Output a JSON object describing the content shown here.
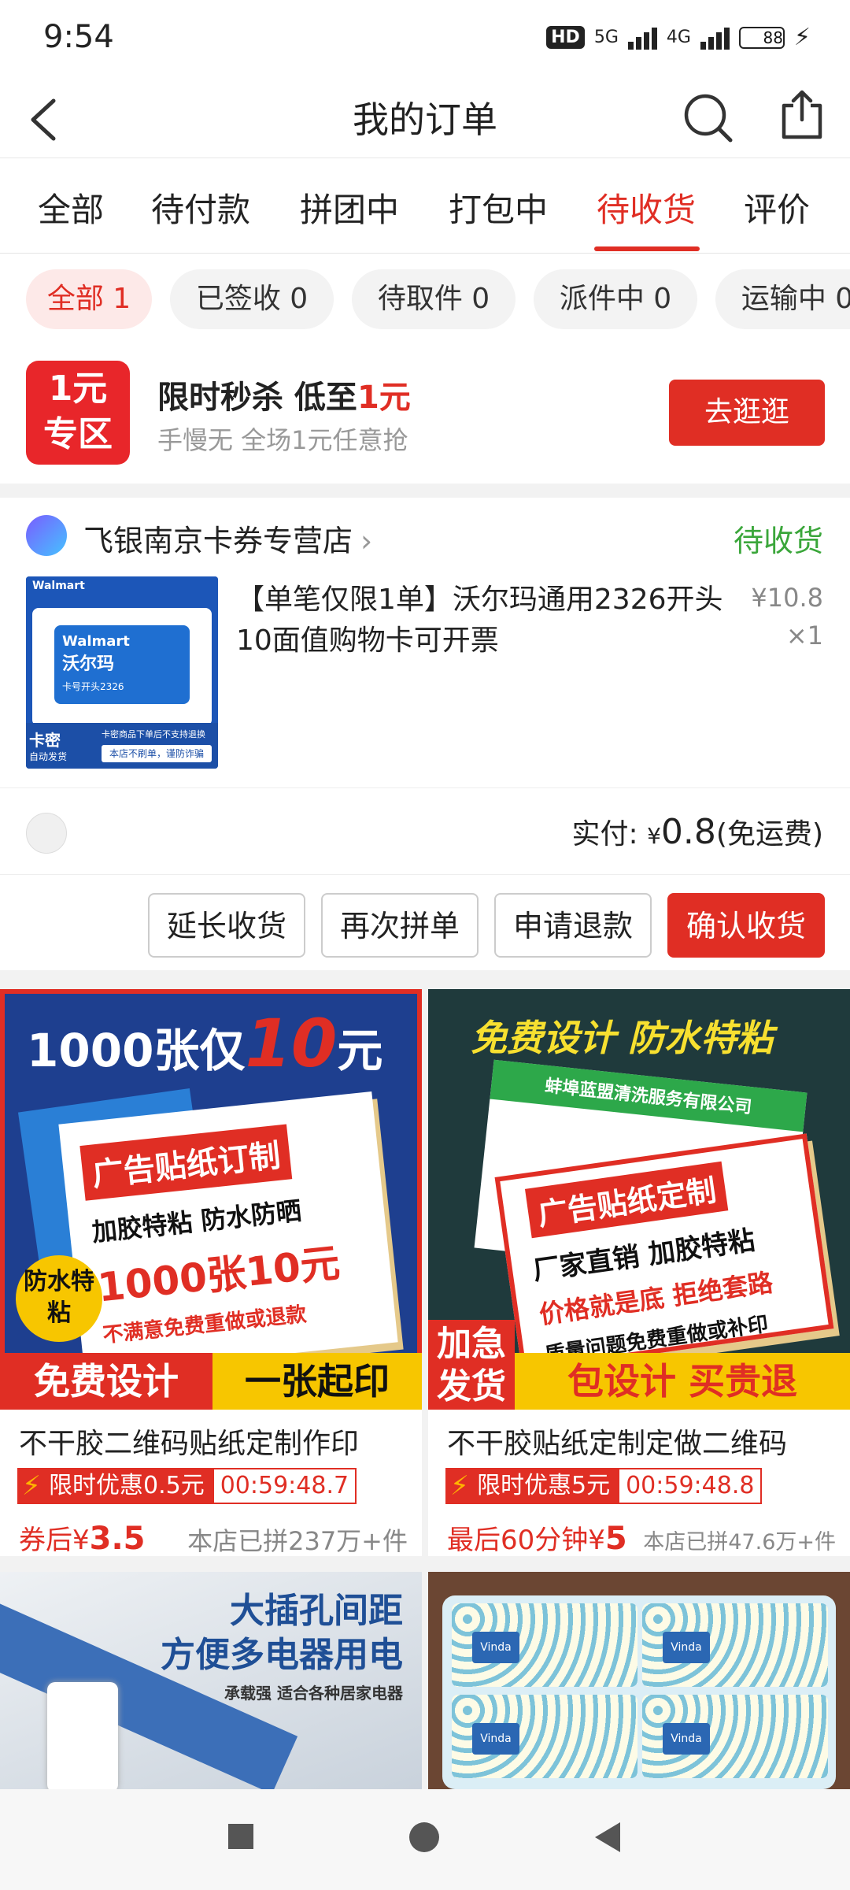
{
  "status_bar": {
    "time": "9:54",
    "hd": "HD",
    "net1": "5G",
    "net2": "4G",
    "battery": "88"
  },
  "header": {
    "title": "我的订单"
  },
  "tabs": [
    {
      "label": "全部"
    },
    {
      "label": "待付款"
    },
    {
      "label": "拼团中"
    },
    {
      "label": "打包中"
    },
    {
      "label": "待收货"
    },
    {
      "label": "评价"
    }
  ],
  "active_tab": "待收货",
  "chips": [
    {
      "label": "全部 1"
    },
    {
      "label": "已签收 0"
    },
    {
      "label": "待取件 0"
    },
    {
      "label": "派件中 0"
    },
    {
      "label": "运输中 0"
    }
  ],
  "promo": {
    "badge_top": "1元",
    "badge_bottom": "专区",
    "title_prefix": "限时秒杀 低至",
    "title_highlight": "1元",
    "subtitle": "手慢无 全场1元任意抢",
    "button": "去逛逛"
  },
  "order": {
    "store_name": "飞银南京卡券专营店",
    "status": "待收货",
    "product_title": "【单笔仅限1单】沃尔玛通用2326开头10面值购物卡可开票",
    "price": "¥10.8",
    "qty": "×1",
    "pay_label": "实付: ",
    "pay_currency": "¥",
    "pay_amount": "0.8",
    "pay_note": "(免运费)",
    "image": {
      "brand": "Walmart",
      "brand_cn": "沃尔玛",
      "card_prefix": "卡号开头2326",
      "tag1": "卡密",
      "tag2": "自动发货",
      "notice1": "卡密商品下单后不支持退换",
      "notice2": "本店不刷单，谨防诈骗"
    },
    "buttons": [
      {
        "label": "延长收货"
      },
      {
        "label": "再次拼单"
      },
      {
        "label": "申请退款"
      },
      {
        "label": "确认收货"
      }
    ]
  },
  "products": [
    {
      "title": "不干胶二维码贴纸定制作印",
      "deal": "限时优惠0.5元",
      "timer": "00:59:48.7",
      "price_prefix": "券后¥",
      "price": "3.5",
      "sold": "本店已拼237万+件",
      "img": {
        "headline_a": "1000张仅",
        "headline_b": "10",
        "headline_c": "元",
        "sticker_title": "广告贴纸订制",
        "line1": "加胶特粘  防水防晒",
        "line2": "1000张10元",
        "line3": "不满意免费重做或退款",
        "badge": "防水特粘",
        "banner_left": "免费设计",
        "banner_right": "一张起印"
      }
    },
    {
      "title": "不干胶贴纸定制定做二维码",
      "deal": "限时优惠5元",
      "timer": "00:59:48.8",
      "price_prefix": "最后60分钟¥",
      "price": "5",
      "sold": "本店已拼47.6万+件",
      "img": {
        "headline": "免费设计  防水特粘",
        "company": "蚌埠蓝盟清洗服务有限公司",
        "sticker_title": "广告贴纸定制",
        "line1": "厂家直销 加胶特粘",
        "line2": "价格就是底 拒绝套路",
        "line3": "质量问题免费重做或补印",
        "banner_left": "加急发货",
        "banner_right": "包设计 买贵退"
      }
    },
    {
      "img": {
        "line1": "大插孔间距",
        "line2": "方便多电器用电",
        "line3": "承载强 适合各种居家电器"
      }
    },
    {
      "img": {
        "brand": "Vinda"
      }
    }
  ]
}
